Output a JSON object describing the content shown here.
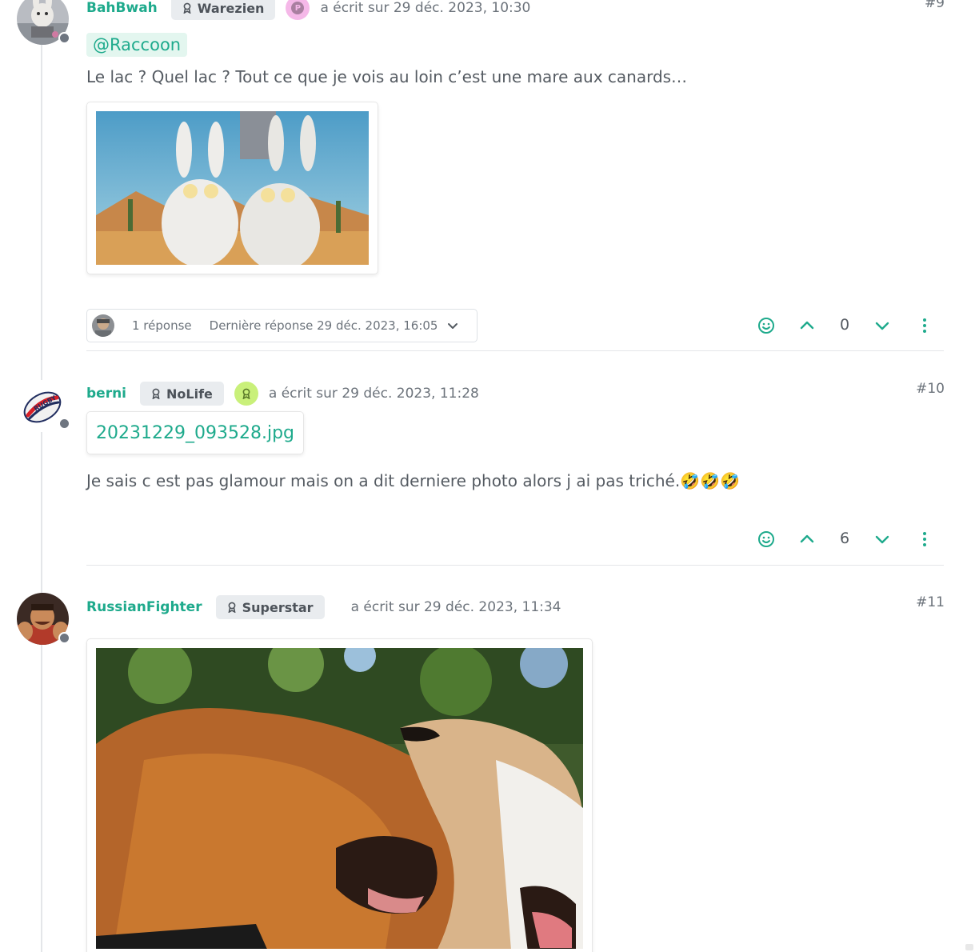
{
  "posts": [
    {
      "username": "BahBwah",
      "group": "Warezien",
      "badge_letter": "P",
      "badge_color": "#f5b8e8",
      "meta": "a écrit sur 29 déc. 2023, 10:30",
      "index": "#9",
      "mention": "@Raccoon",
      "text": "Le lac ? Quel lac ? Tout ce que je vois au loin c’est une mare aux canards…",
      "replies": {
        "count_label": "1 réponse",
        "last_label": "Dernière réponse 29 déc. 2023, 16:05"
      },
      "votes": "0"
    },
    {
      "username": "berni",
      "group": "NoLife",
      "badge_color": "#c9f07a",
      "meta": "a écrit sur 29 déc. 2023, 11:28",
      "index": "#10",
      "attachment": "20231229_093528.jpg",
      "text": "Je sais c est pas glamour mais on a dit derniere photo alors j ai pas triché.🤣🤣🤣",
      "votes": "6"
    },
    {
      "username": "RussianFighter",
      "group": "Superstar",
      "meta": "a écrit sur 29 déc. 2023, 11:34",
      "index": "#11"
    }
  ],
  "icons": {
    "react": "smile-icon",
    "upvote": "chevron-up-icon",
    "downvote": "chevron-down-icon",
    "more": "kebab-menu-icon",
    "group": "award-icon"
  },
  "colors": {
    "accent": "#1eaa8c",
    "muted": "#6c737b",
    "badge_bg": "#e9ecef"
  }
}
